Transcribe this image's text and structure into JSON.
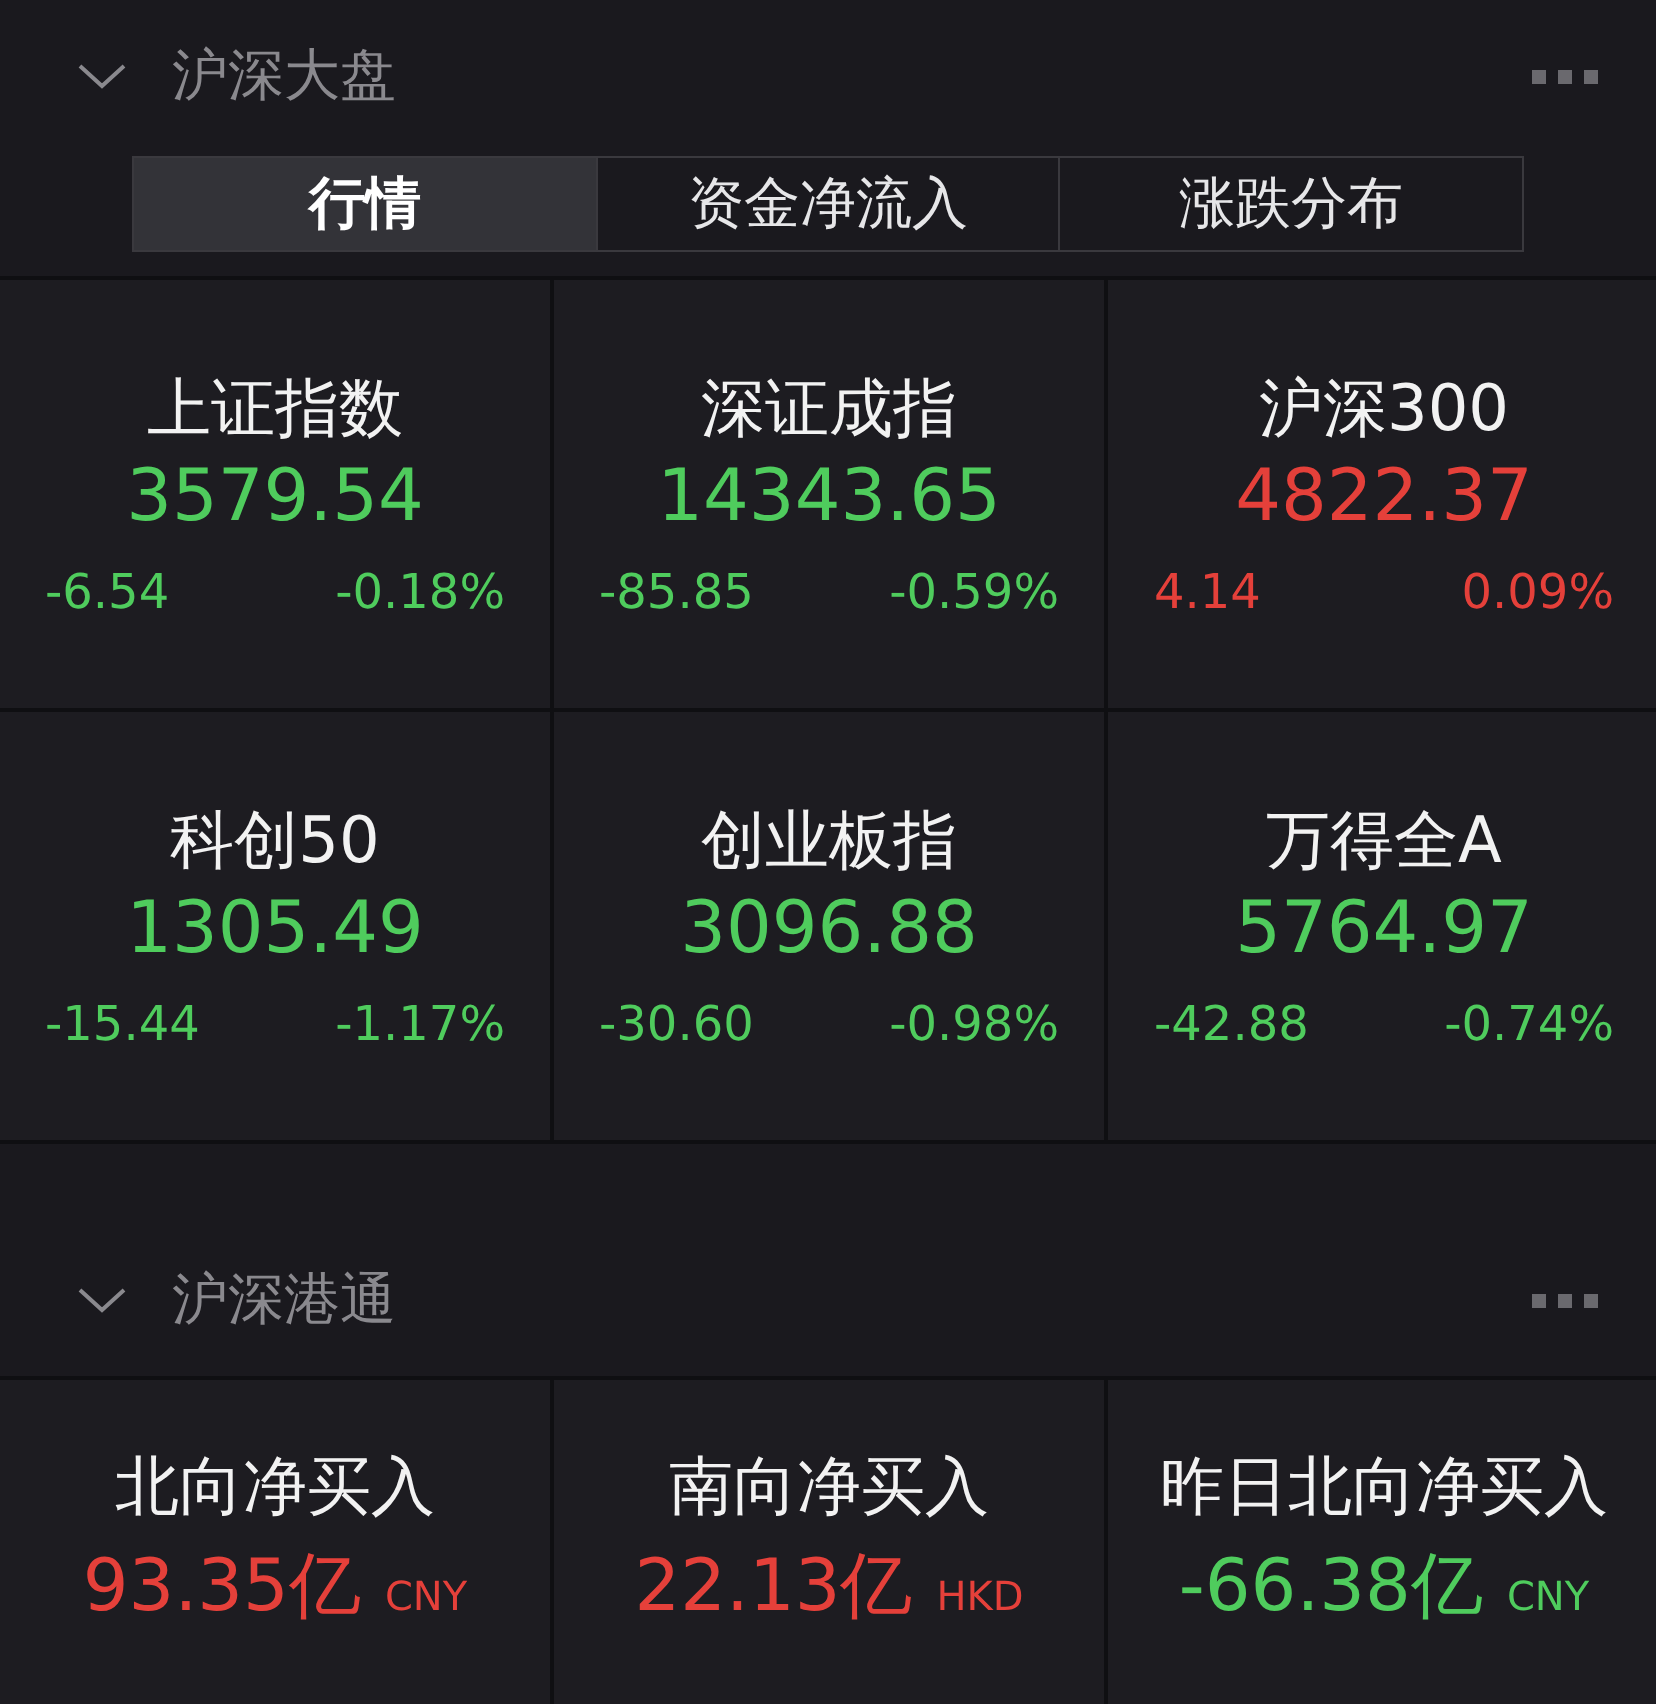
{
  "sections": [
    {
      "title": "沪深大盘",
      "expanded": true,
      "tabs": [
        {
          "label": "行情",
          "selected": true
        },
        {
          "label": "资金净流入",
          "selected": false
        },
        {
          "label": "涨跌分布",
          "selected": false
        }
      ],
      "cards": [
        {
          "name": "上证指数",
          "value": "3579.54",
          "change": "-6.54",
          "percent": "-0.18%",
          "color": "#4fcc5d"
        },
        {
          "name": "深证成指",
          "value": "14343.65",
          "change": "-85.85",
          "percent": "-0.59%",
          "color": "#4fcc5d"
        },
        {
          "name": "沪深300",
          "value": "4822.37",
          "change": "4.14",
          "percent": "0.09%",
          "color": "#e5403a"
        },
        {
          "name": "科创50",
          "value": "1305.49",
          "change": "-15.44",
          "percent": "-1.17%",
          "color": "#4fcc5d"
        },
        {
          "name": "创业板指",
          "value": "3096.88",
          "change": "-30.60",
          "percent": "-0.98%",
          "color": "#4fcc5d"
        },
        {
          "name": "万得全A",
          "value": "5764.97",
          "change": "-42.88",
          "percent": "-0.74%",
          "color": "#4fcc5d"
        }
      ]
    },
    {
      "title": "沪深港通",
      "expanded": true,
      "cards": [
        {
          "name": "北向净买入",
          "value": "93.35亿",
          "unit": "CNY",
          "color": "#e5403a"
        },
        {
          "name": "南向净买入",
          "value": "22.13亿",
          "unit": "HKD",
          "color": "#e5403a"
        },
        {
          "name": "昨日北向净买入",
          "value": "-66.38亿",
          "unit": "CNY",
          "color": "#4fcc5d"
        }
      ]
    }
  ]
}
